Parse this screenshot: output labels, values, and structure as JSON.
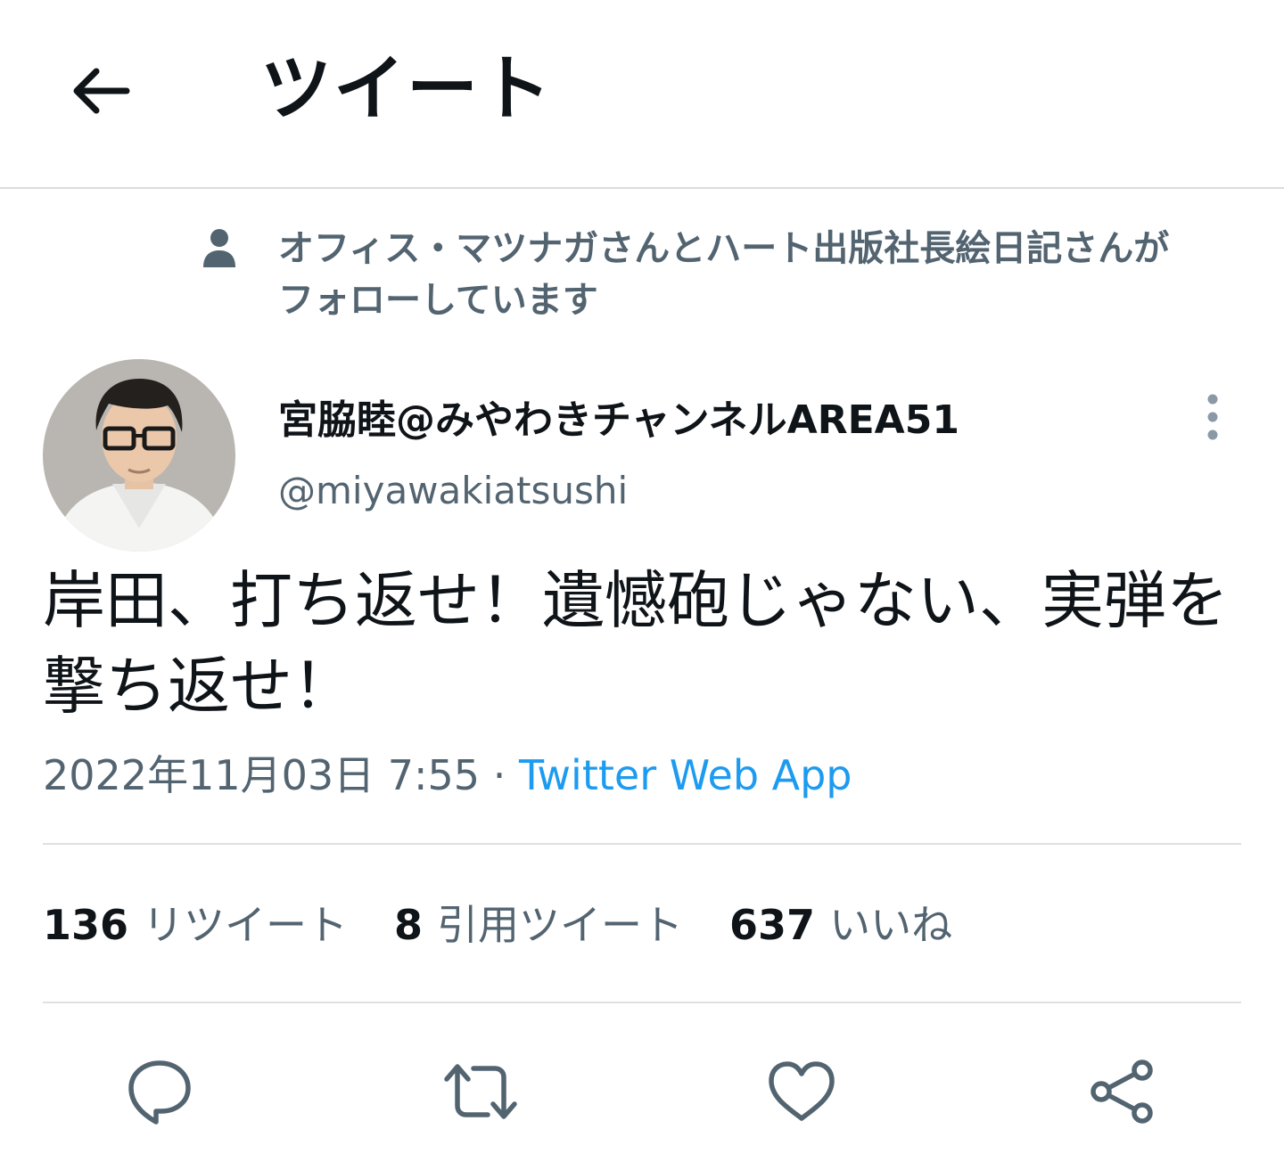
{
  "header": {
    "title": "ツイート",
    "back_icon": "arrow-left-icon"
  },
  "social_context": {
    "icon": "person-icon",
    "text_line1": "オフィス・マツナガさんとハート出版社長絵日記さんが",
    "text_line2": "フォローしています"
  },
  "author": {
    "display_name": "宮脇睦@みやわきチャンネルAREA51",
    "handle": "@miyawakiatsushi",
    "more_icon": "more-vertical-icon"
  },
  "tweet": {
    "text": "岸田、打ち返せ！遺憾砲じゃない、実弾を撃ち返せ！",
    "timestamp": "2022年11月03日 7:55",
    "separator": "·",
    "source": "Twitter Web App"
  },
  "stats": {
    "retweets_count": "136",
    "retweets_label": "リツイート",
    "quotes_count": "8",
    "quotes_label": "引用ツイート",
    "likes_count": "637",
    "likes_label": "いいね"
  },
  "actions": {
    "reply_icon": "reply-icon",
    "retweet_icon": "retweet-icon",
    "like_icon": "heart-icon",
    "share_icon": "share-icon"
  },
  "colors": {
    "text_primary": "#0f1419",
    "text_secondary": "#536471",
    "link": "#1d9bf0",
    "divider": "#dde1e4"
  }
}
